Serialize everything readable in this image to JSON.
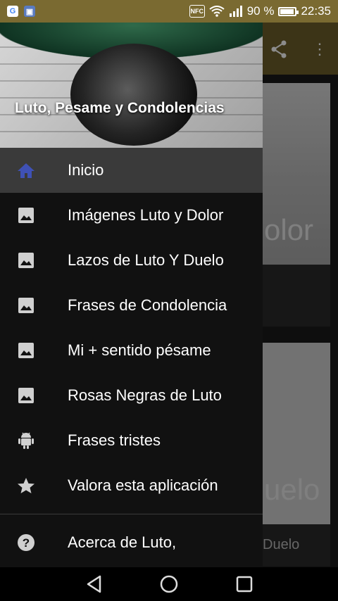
{
  "status_bar": {
    "battery_percent": "90 %",
    "time": "22:35",
    "battery_level": 0.9,
    "icons": [
      "google-icon",
      "image-notification-icon",
      "nfc-icon",
      "wifi-icon",
      "signal-icon",
      "battery-icon"
    ]
  },
  "drawer": {
    "header_title": "Luto, Pesame y Condolencias",
    "items": [
      {
        "label": "Inicio",
        "icon": "home-icon",
        "active": true
      },
      {
        "label": "Imágenes Luto y Dolor",
        "icon": "image-icon"
      },
      {
        "label": "Lazos de Luto Y Duelo",
        "icon": "image-icon"
      },
      {
        "label": "Frases de Condolencia",
        "icon": "image-icon"
      },
      {
        "label": "Mi +  sentido pésame",
        "icon": "image-icon"
      },
      {
        "label": "Rosas Negras de Luto",
        "icon": "image-icon"
      },
      {
        "label": "Frases tristes",
        "icon": "android-icon"
      },
      {
        "label": "Valora esta aplicación",
        "icon": "star-icon"
      }
    ],
    "footer_item": {
      "label": "Acerca de Luto,",
      "icon": "help-icon"
    }
  },
  "background_app": {
    "card1_text": "olor",
    "card2_text": "uelo",
    "card2_label": "Duelo"
  },
  "colors": {
    "status_bar": "#7a6a31",
    "app_bar": "#6e5f2a",
    "home_icon": "#3f51b5"
  }
}
